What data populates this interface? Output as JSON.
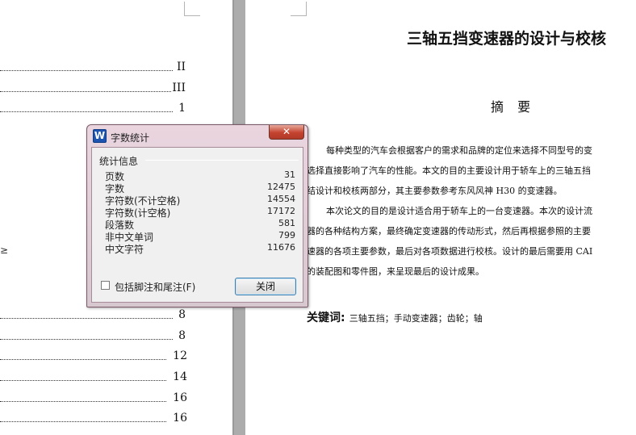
{
  "toc": {
    "entries": [
      {
        "page": "II"
      },
      {
        "page": "III"
      },
      {
        "page": "1"
      },
      {
        "page": "8"
      },
      {
        "page": "8"
      },
      {
        "page": "12"
      },
      {
        "page": "14"
      },
      {
        "page": "16"
      },
      {
        "page": "16"
      }
    ],
    "stub": "≥"
  },
  "document": {
    "title": "三轴五挡变速器的设计与校核",
    "abstract_title": "摘 要",
    "paragraphs": [
      "每种类型的汽车会根据客户的需求和品牌的定位来选择不同型号的变",
      "选择直接影响了汽车的性能。本文的目的主要设计用于轿车上的三轴五挡",
      "结设计和校核两部分，其主要参数参考东风风神 H30 的变速器。",
      "本次论文的目的是设计适合用于轿车上的一台变速器。本次的设计流",
      "器的各种结构方案，最终确定变速器的传动形式，然后再根据参照的主要",
      "速器的各项主要参数，最后对各项数据进行校核。设计的最后需要用 CAI",
      "的装配图和零件图，来呈现最后的设计成果。"
    ],
    "keywords_label": "关键词:",
    "keywords_text": "三轴五挡；手动变速器；齿轮；轴"
  },
  "dialog": {
    "icon_letter": "W",
    "title": "字数统计",
    "close_glyph": "✕",
    "group_label": "统计信息",
    "stats": [
      {
        "label": "页数",
        "value": "31"
      },
      {
        "label": "字数",
        "value": "12475"
      },
      {
        "label": "字符数(不计空格)",
        "value": "14554"
      },
      {
        "label": "字符数(计空格)",
        "value": "17172"
      },
      {
        "label": "段落数",
        "value": "581"
      },
      {
        "label": "非中文单词",
        "value": "799"
      },
      {
        "label": "中文字符",
        "value": "11676"
      }
    ],
    "checkbox_label": "包括脚注和尾注(F)",
    "checkbox_checked": false,
    "close_button_label": "关闭"
  }
}
